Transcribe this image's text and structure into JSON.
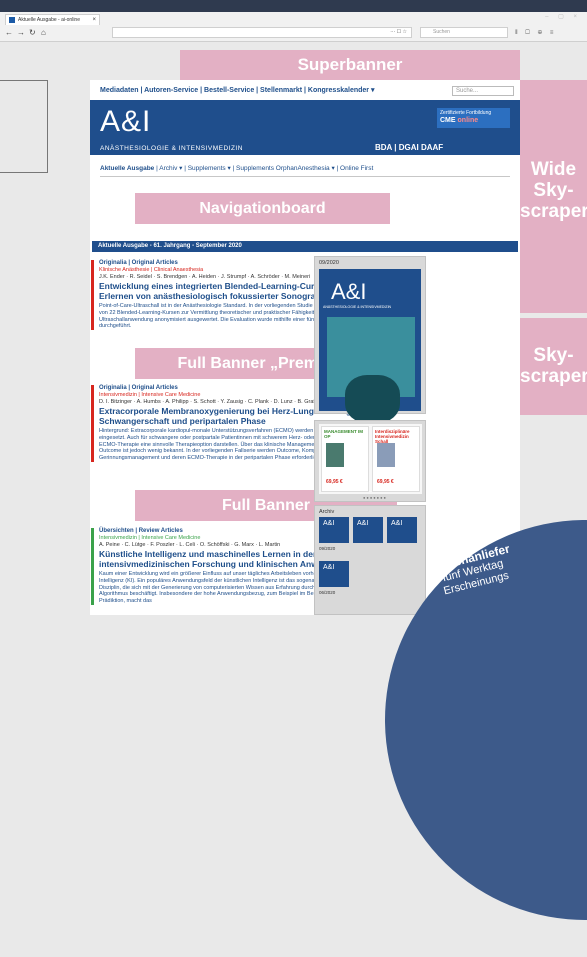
{
  "browser": {
    "tab_title": "Aktuelle Ausgabe - ai-online",
    "tab_close": "×",
    "url_icons": "··· ☐ ☆",
    "search_placeholder": "Suchen",
    "toolbar_icons": "⫴ ▢ ⊕ ≡",
    "window_controls": "– ▢ ×"
  },
  "ads": {
    "superbanner": "Superbanner",
    "wide_skyscraper": "Wide Sky-scraper",
    "skyscraper": "Sky-scraper",
    "navigationboard": "Navigationboard",
    "full_banner_premium": "Full Banner „Premium“",
    "full_banner": "Full Banner"
  },
  "site": {
    "toplinks": "Mediadaten | Autoren-Service | Bestell-Service | Stellenmarkt | Kongresskalender ▾",
    "search_placeholder": "Suche...",
    "logo": "A&I",
    "subtitle": "ANÄSTHESIOLOGIE & INTENSIVMEDIZIN",
    "cme_line1": "Zertifizierte Fortbildung",
    "cme_line2": "CME",
    "cme_line3": "online",
    "brands": "BDA  |  DGAI  DAAF",
    "nav": {
      "current": "Aktuelle Ausgabe",
      "archiv": "Archiv ▾",
      "supplements": "Supplements ▾",
      "orphan": "Supplements OrphanAnesthesia ▾",
      "online_first": "Online First",
      "sep": " | "
    },
    "issue_bar": "Aktuelle Ausgabe - 61. Jahrgang - September 2020"
  },
  "articles": [
    {
      "kind": "Originalia | Original Articles",
      "section": "Klinische Anästhesie | Clinical Anaesthesia",
      "authors": "J.K. Ender · R. Seidel · S. Brendgen · A. Heiden · J. Strumpf · A. Schröder · M. Meineri",
      "title": "Entwicklung eines integrierten Blended-Learning-Curriculums zum Erlernen von anästhesiologisch fokussierter Sonographie",
      "text": "Point-of-Care-Ultraschall ist in der Anästhesiologie Standard. In der vorliegenden Studie wurden die Evaluationsbögen von 22 Blended-Learning-Kursen zur Vermittlung theoretischer und praktischer Fähigkeiten im Bereich klinischer Ultraschallanwendung anonymisiert ausgewertet. Die Evaluation wurde mithilfe einer fünfstufigen Likertskala durchgeführt."
    },
    {
      "kind": "Originalia | Original Articles",
      "section": "Intensivmedizin | Intensive Care Medicine",
      "authors": "D. I. Bitzinger · A. Humbs · A. Philipp · S. Schott · Y. Zausig · C. Plank · D. Lunz · B. Graf",
      "title": "Extracorporale Membranoxygenierung bei Herz-Lungenversagen in der Schwangerschaft und peripartalen Phase",
      "text": "Hintergrund: Extracorporale kardiopul-monale Unterstützungsverfahren (ECMO) werden mit zunehmender Häufigkeit eingesetzt. Auch für schwangere oder postpartale Patientinnen mit schwerem Herz- oder Lungenversagen kann eine ECMO-Therapie eine sinnvolle Therapieoption darstellen. Über das klinische Management dieser Patientinnen und deren Outcome ist jedoch wenig bekannt. In der vorliegenden Fallserie werden Outcome, Komplikationen, Gerinnungsmanagement und deren ECMO-Therapie in der peripartalen Phase erforderlich wurde."
    },
    {
      "kind": "Übersichten | Review Articles",
      "section": "Intensivmedizin | Intensive Care Medicine",
      "authors": "A. Peine · C. Lütge · F. Poszler · L. Celi · O. Schöffski · G. Marx · L. Martin",
      "title": "Künstliche Intelligenz und maschinelles Lernen in der intensivmedizinischen Forschung und klinischen Anwendung",
      "text": "Kaum einer Entwicklung wird ein größerer Einfluss auf unser tägliches Arbeitsleben vorhergesagt, als der künstlichen Intelligenz (KI). Ein populäres Anwendungsfeld der künstlichen Intelligenz ist das sogenannte maschinelle Lernen, die Disziplin, die sich mit der Generierung von computerisierten Wissen aus Erfahrung durch einen selbstadaptiven Algorithmus beschäftigt. Insbesondere der hohe Anwendungsbezug, zum Beispiel im Bereich der Mustererkennung und Prädiktion, macht das"
    }
  ],
  "sidebar": {
    "issue_label": "09/2020",
    "cover_logo": "A&I",
    "cover_sub": "ANÄSTHESIOLOGIE & INTENSIVMEDIZIN",
    "ad_left_title": "MANAGEMENT IM OP",
    "ad_right_title": "Interdisziplinäre Intensivmedizin Schall",
    "ad_left_price": "69,95 €",
    "ad_right_price": "69,95 €",
    "pager": "●●●●●●●",
    "archive_label": "Archiv",
    "archive_dates": [
      "09/2020",
      "08/2020",
      "07/2020",
      "06/2020"
    ]
  },
  "promo": {
    "line1": "Datenanliefer",
    "line2": "fünf Werktag",
    "line3": "Erscheinungs"
  }
}
